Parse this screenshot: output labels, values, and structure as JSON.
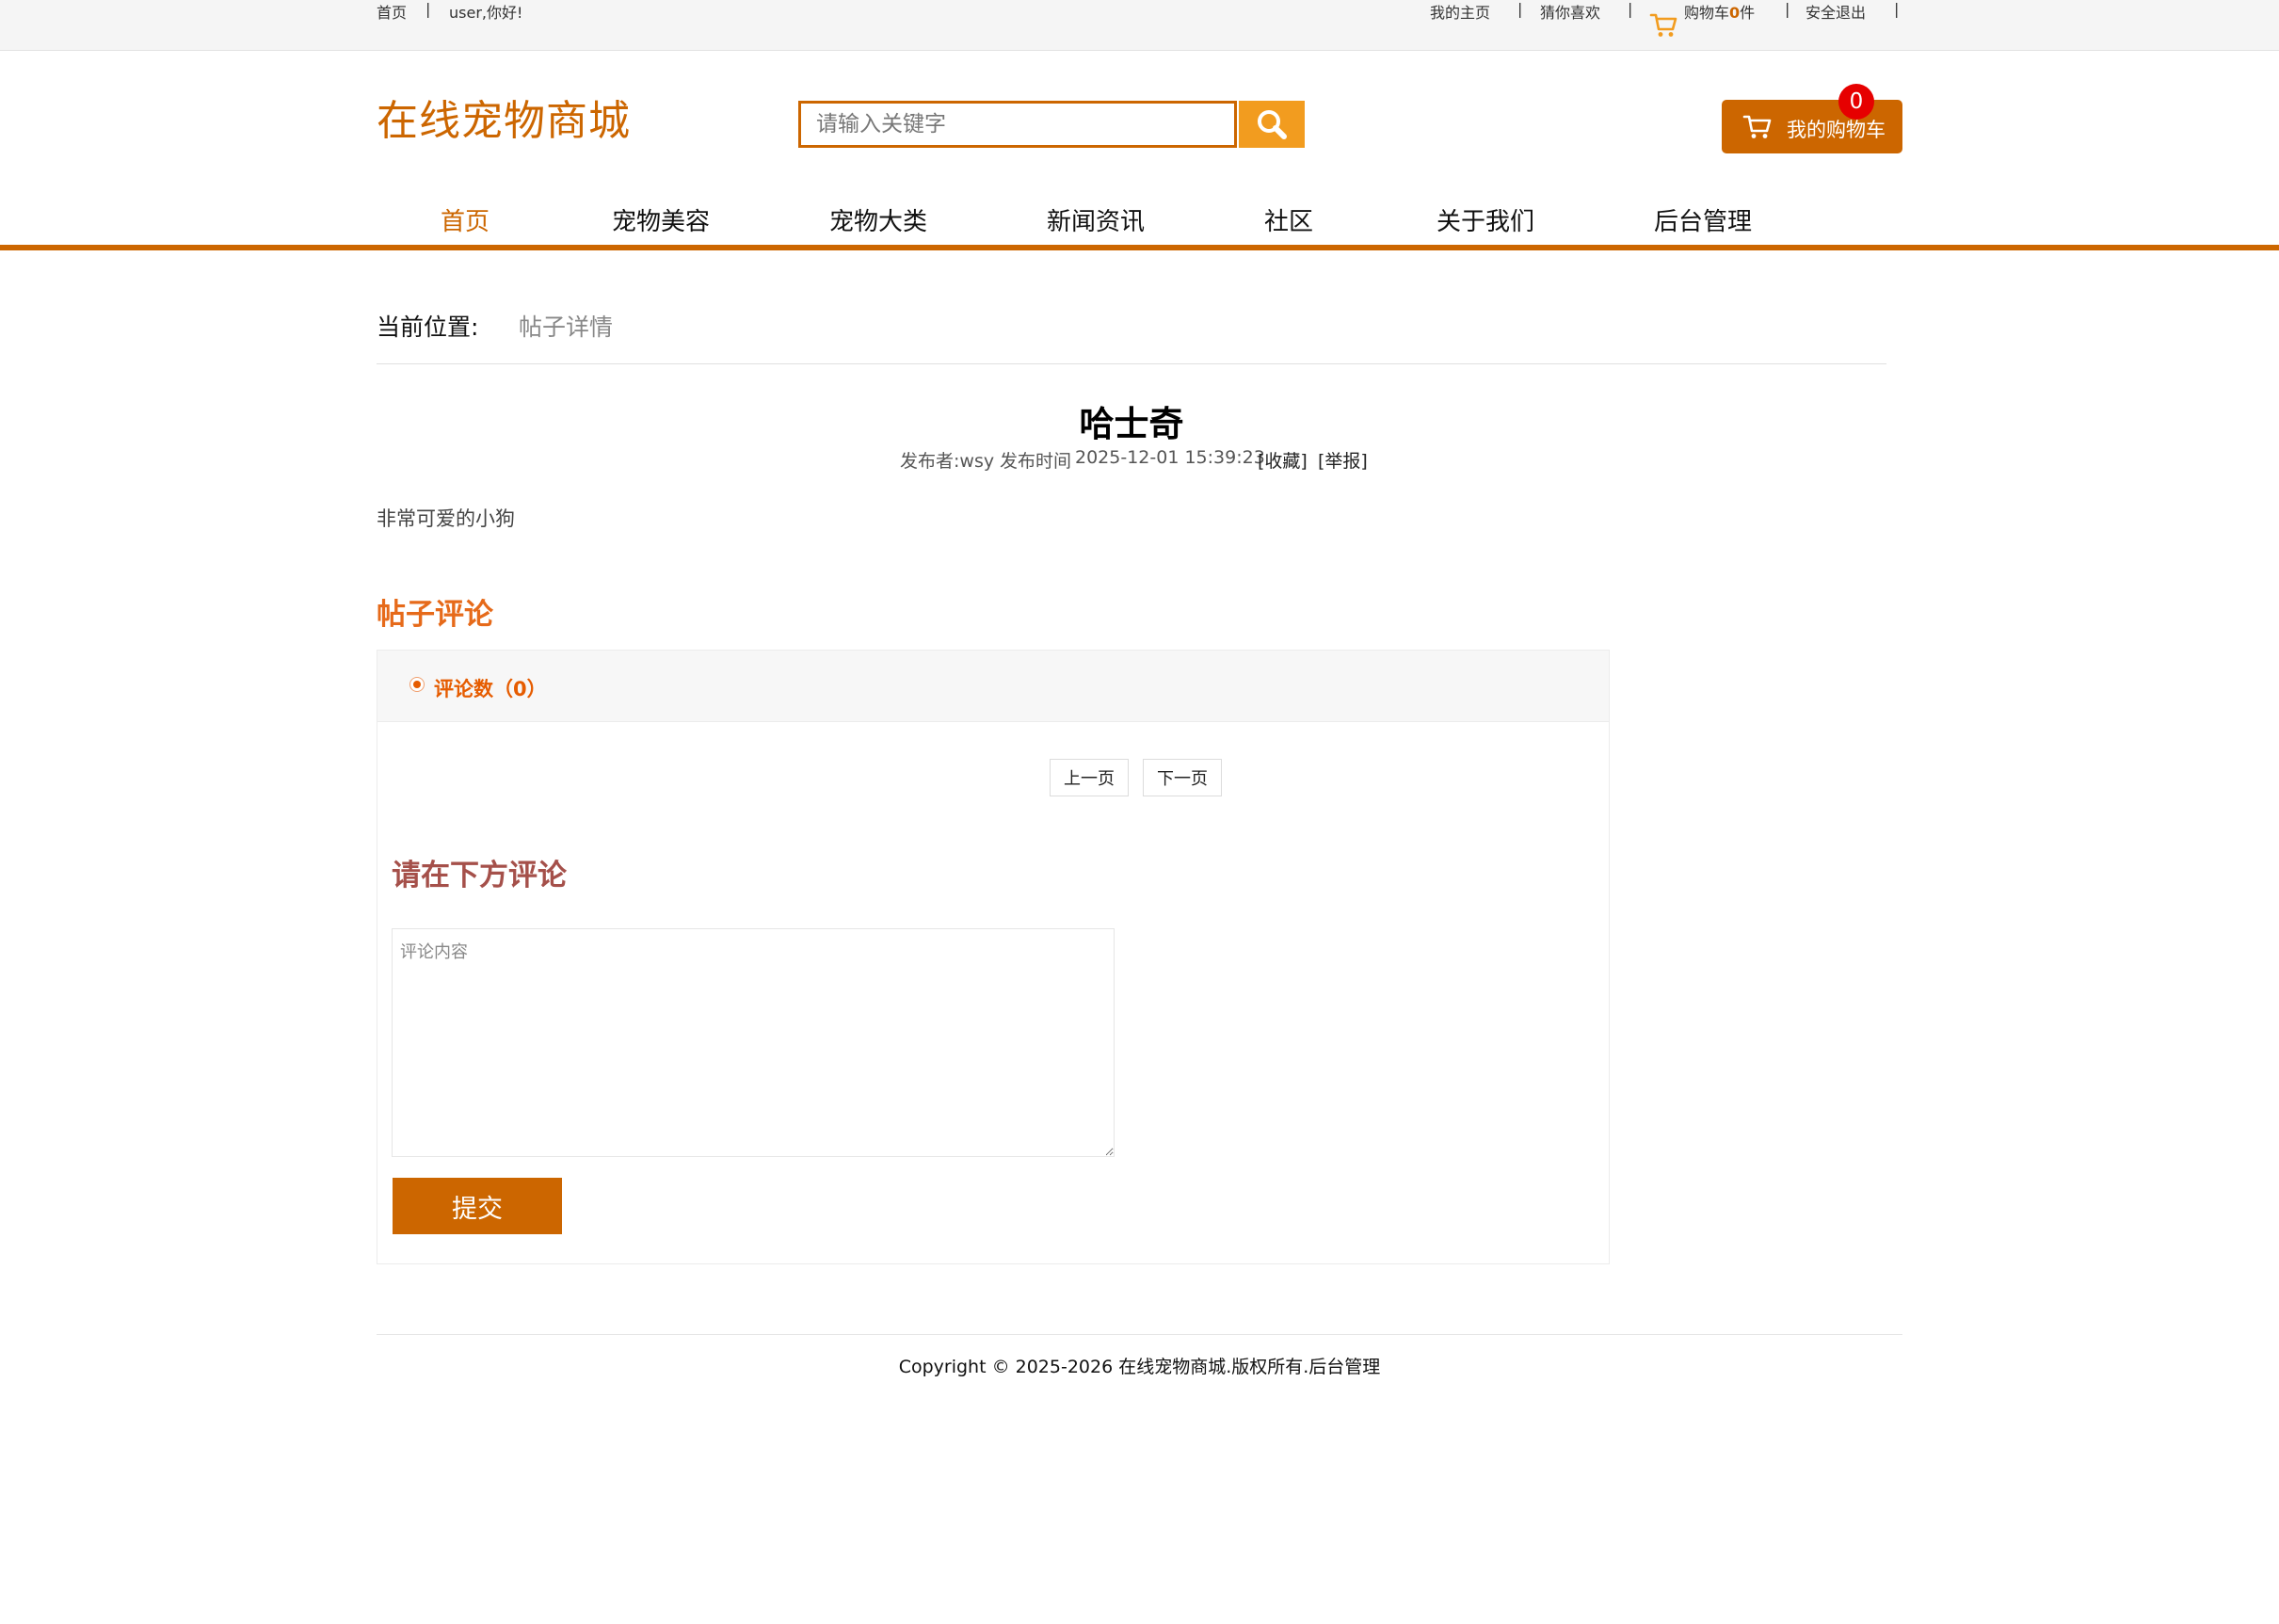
{
  "topbar": {
    "home": "首页",
    "divider": "|",
    "greeting": "user,你好!",
    "my_home": "我的主页",
    "guess_like": "猜你喜欢",
    "cart_prefix": "购物车",
    "cart_count": "0",
    "cart_suffix": "件",
    "logout": "安全退出"
  },
  "header": {
    "logo": "在线宠物商城",
    "search_placeholder": "请输入关键字",
    "cart_label": "我的购物车",
    "cart_badge": "0"
  },
  "nav": {
    "items": [
      {
        "label": "首页"
      },
      {
        "label": "宠物美容"
      },
      {
        "label": "宠物大类"
      },
      {
        "label": "新闻资讯"
      },
      {
        "label": "社区"
      },
      {
        "label": "关于我们"
      },
      {
        "label": "后台管理"
      }
    ]
  },
  "breadcrumb": {
    "label": "当前位置:",
    "current": "帖子详情"
  },
  "post": {
    "title": "哈士奇",
    "author_label": "发布者:wsy",
    "time_label": "发布时间",
    "time": "2025-12-01 15:39:23",
    "favorite": "[收藏]",
    "report": "[举报]",
    "body": "非常可爱的小狗"
  },
  "comments": {
    "heading": "帖子评论",
    "count_label": "评论数（0）",
    "prev": "上一页",
    "next": "下一页",
    "form_heading": "请在下方评论",
    "placeholder": "评论内容",
    "submit": "提交"
  },
  "footer": {
    "copyright": "Copyright © 2025-2026 在线宠物商城.版权所有.后台管理"
  },
  "colors": {
    "brand": "#cc6600",
    "search_button": "#f29c1f",
    "badge": "#e60000",
    "comment_heading": "#e66a1a",
    "form_heading": "#a5504a"
  }
}
